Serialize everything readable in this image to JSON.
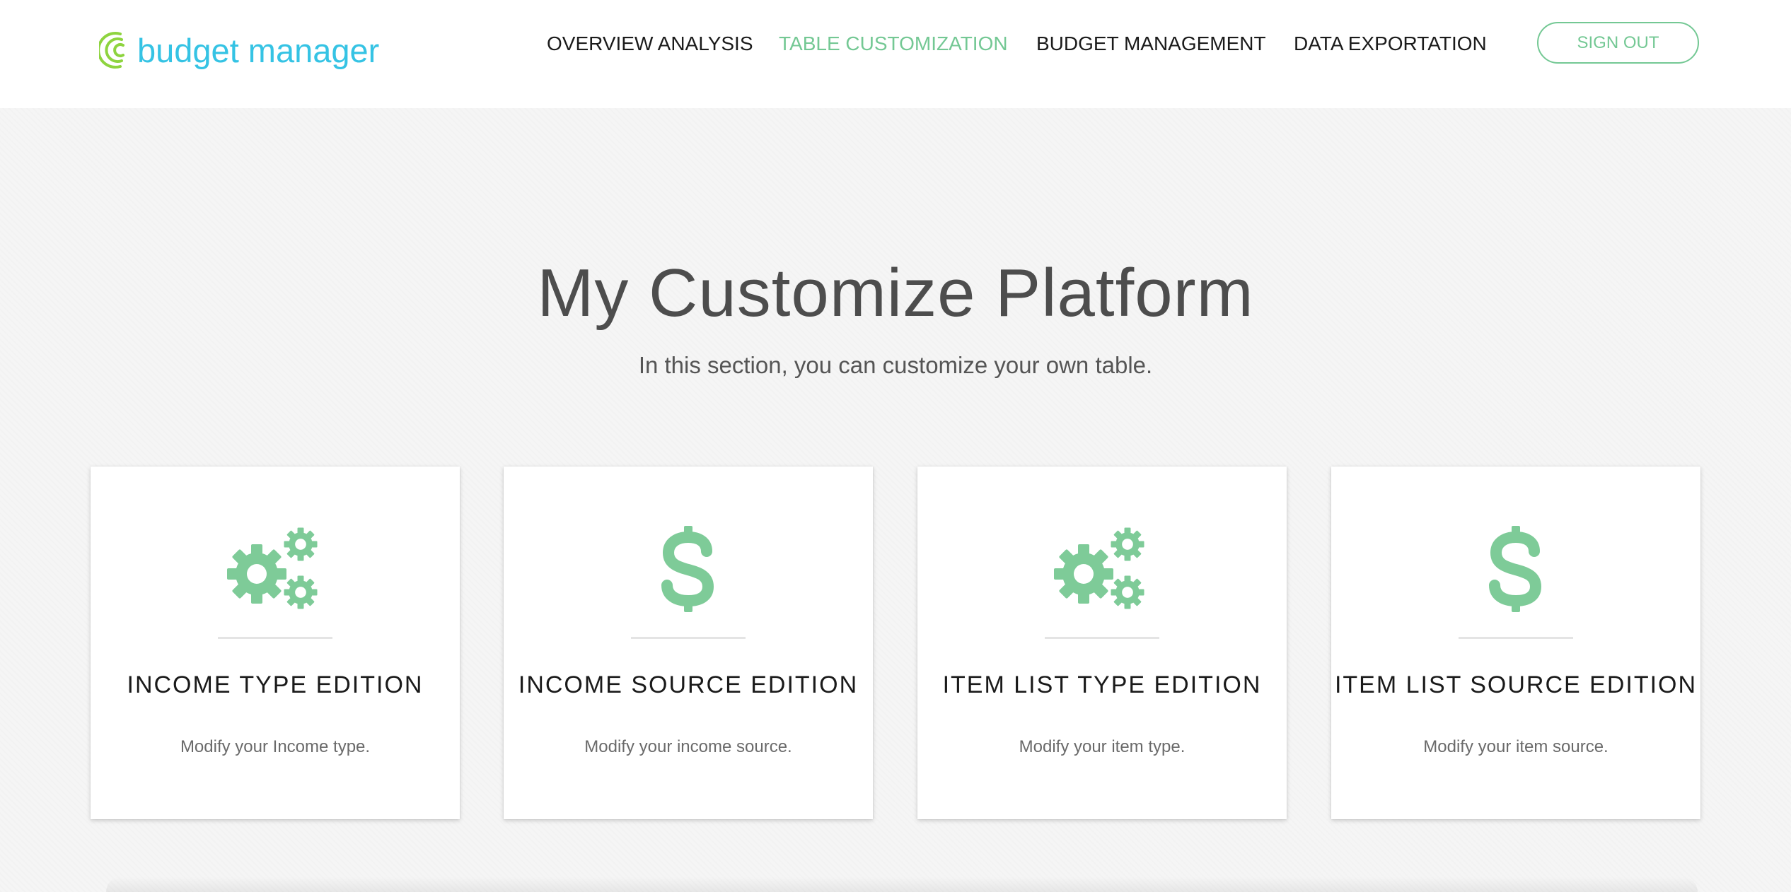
{
  "brand": {
    "name": "budget manager",
    "logo_icon": "spiral-arcs-icon",
    "color_text": "#35c3e4",
    "color_mark": "#8ed43f"
  },
  "nav": {
    "items": [
      {
        "label": "OVERVIEW ANALYSIS",
        "active": false
      },
      {
        "label": "TABLE CUSTOMIZATION",
        "active": true
      },
      {
        "label": "BUDGET MANAGEMENT",
        "active": false
      },
      {
        "label": "DATA EXPORTATION",
        "active": false
      }
    ],
    "sign_out_label": "SIGN OUT",
    "accent_color": "#74c894"
  },
  "hero": {
    "title": "My Customize Platform",
    "subtitle": "In this section, you can customize your own table."
  },
  "cards": [
    {
      "icon": "gears-icon",
      "title": "INCOME TYPE EDITION",
      "description": "Modify your Income type."
    },
    {
      "icon": "dollar-icon",
      "title": "INCOME SOURCE EDITION",
      "description": "Modify your income source."
    },
    {
      "icon": "gears-icon",
      "title": "ITEM LIST TYPE EDITION",
      "description": "Modify your item type."
    },
    {
      "icon": "dollar-icon",
      "title": "ITEM LIST SOURCE EDITION",
      "description": "Modify your item source."
    }
  ],
  "colors": {
    "icon": "#7ecb98",
    "background": "#f5f5f5"
  }
}
